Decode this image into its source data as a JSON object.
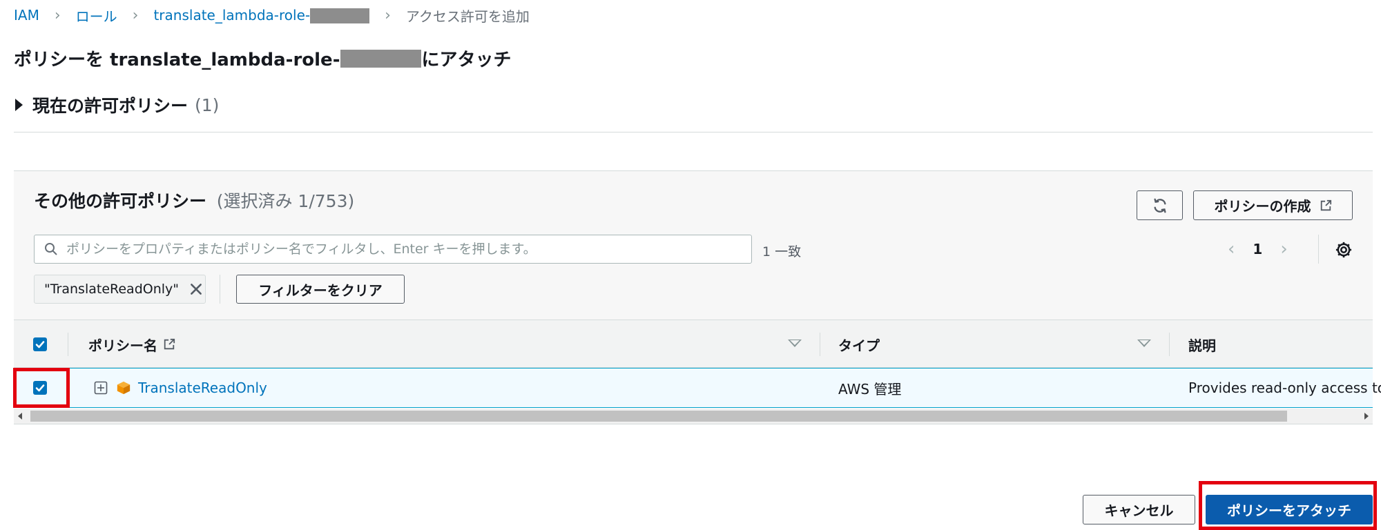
{
  "breadcrumb": {
    "items": [
      "IAM",
      "ロール",
      "translate_lambda-role-"
    ],
    "current": "アクセス許可を追加"
  },
  "page": {
    "title_prefix": "ポリシーを translate_lambda-role-",
    "title_suffix": " にアタッチ"
  },
  "current_policies": {
    "label": "現在の許可ポリシー",
    "count": "(1)"
  },
  "other_policies": {
    "title": "その他の許可ポリシー",
    "count": "(選択済み 1/753)",
    "create_button": "ポリシーの作成",
    "search_placeholder": "ポリシーをプロパティまたはポリシー名でフィルタし、Enter キーを押します。",
    "match_text": "1 一致",
    "page_number": "1",
    "filter_token": "\"TranslateReadOnly\"",
    "clear_filter_button": "フィルターをクリア"
  },
  "table": {
    "columns": [
      "ポリシー名",
      "タイプ",
      "説明"
    ],
    "rows": [
      {
        "selected": true,
        "name": "TranslateReadOnly",
        "type": "AWS 管理",
        "description": "Provides read-only access to A"
      }
    ]
  },
  "footer": {
    "cancel_button": "キャンセル",
    "attach_button": "ポリシーをアタッチ"
  },
  "colors": {
    "link": "#0073bb",
    "primary_button": "#0b5cad",
    "highlight": "#e3000f",
    "aws_cube": "#f29100"
  }
}
